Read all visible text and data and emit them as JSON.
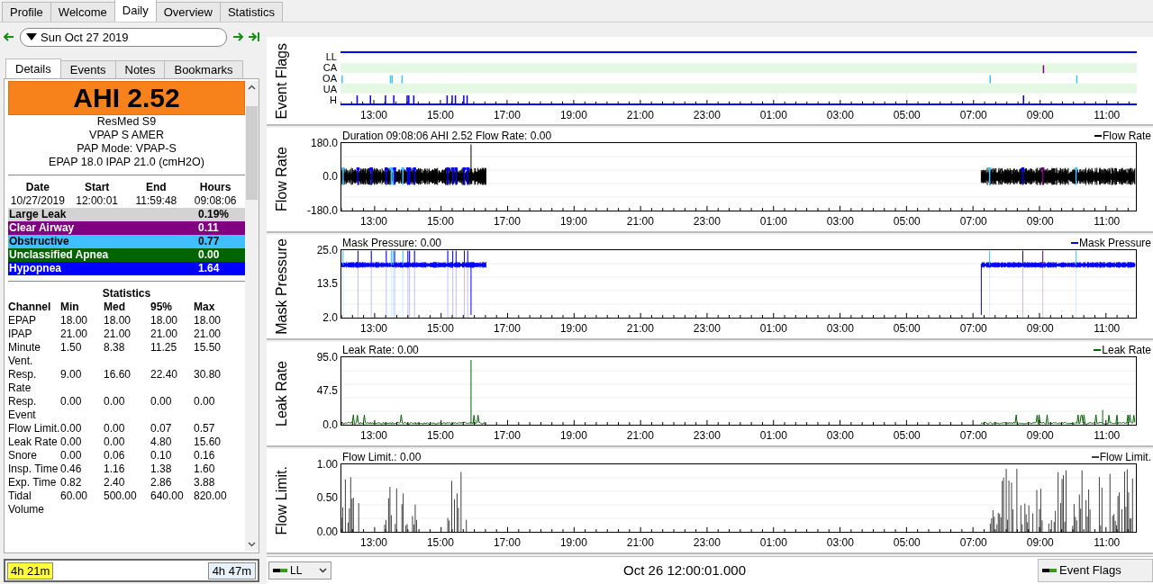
{
  "tabs": [
    {
      "label": "Profile",
      "selected": false
    },
    {
      "label": "Welcome",
      "selected": false
    },
    {
      "label": "Daily",
      "selected": true
    },
    {
      "label": "Overview",
      "selected": false
    },
    {
      "label": "Statistics",
      "selected": false
    }
  ],
  "date_nav": {
    "date": "Sun Oct 27 2019"
  },
  "detail_tabs": [
    {
      "label": "Details",
      "selected": true
    },
    {
      "label": "Events",
      "selected": false
    },
    {
      "label": "Notes",
      "selected": false
    },
    {
      "label": "Bookmarks",
      "selected": false
    }
  ],
  "summary": {
    "ahi": "AHI 2.52",
    "lines": [
      "ResMed S9",
      "VPAP S AMER",
      "PAP Mode: VPAP-S",
      "EPAP 18.0 IPAP 21.0 (cmH2O)"
    ],
    "session_columns": [
      "Date",
      "Start",
      "End",
      "Hours"
    ],
    "session_values": [
      "10/27/2019",
      "12:00:01",
      "11:59:48",
      "09:08:06"
    ],
    "indices": [
      {
        "label": "Large Leak",
        "value": "0.19%",
        "color": "#d3d3d3"
      },
      {
        "label": "Clear Airway",
        "value": "0.11",
        "color": "#800080"
      },
      {
        "label": "Obstructive",
        "value": "0.77",
        "color": "#40c0ff"
      },
      {
        "label": "Unclassified Apnea",
        "value": "0.00",
        "color": "#006400"
      },
      {
        "label": "Hypopnea",
        "value": "1.64",
        "color": "#0000ff"
      }
    ]
  },
  "statistics": {
    "title": "Statistics",
    "columns": [
      "Channel",
      "Min",
      "Med",
      "95%",
      "Max"
    ],
    "rows": [
      [
        "EPAP",
        "18.00",
        "18.00",
        "18.00",
        "18.00"
      ],
      [
        "IPAP",
        "21.00",
        "21.00",
        "21.00",
        "21.00"
      ],
      [
        "Minute Vent.",
        "1.50",
        "8.38",
        "11.25",
        "15.50"
      ],
      [
        "Resp. Rate",
        "9.00",
        "16.60",
        "22.40",
        "30.80"
      ],
      [
        "Resp. Event",
        "0.00",
        "0.00",
        "0.00",
        "0.00"
      ],
      [
        "Flow Limit.",
        "0.00",
        "0.00",
        "0.07",
        "0.57"
      ],
      [
        "Leak Rate",
        "0.00",
        "0.00",
        "4.80",
        "15.60"
      ],
      [
        "Snore",
        "0.00",
        "0.06",
        "0.10",
        "0.16"
      ],
      [
        "Insp. Time",
        "0.46",
        "1.16",
        "1.38",
        "1.60"
      ],
      [
        "Exp. Time",
        "0.82",
        "2.40",
        "2.86",
        "3.88"
      ],
      [
        "Tidal Volume",
        "60.00",
        "500.00",
        "640.00",
        "820.00"
      ]
    ]
  },
  "durations": {
    "left": "4h 21m",
    "right": "4h 47m"
  },
  "graphs": [
    {
      "kind": "flags",
      "label": "Event Flags",
      "rows": [
        "LL",
        "CA",
        "OA",
        "UA",
        "H"
      ],
      "xticks": [
        "13:00",
        "15:00",
        "17:00",
        "19:00",
        "21:00",
        "23:00",
        "01:00",
        "03:00",
        "05:00",
        "07:00",
        "09:00",
        "11:00"
      ]
    },
    {
      "kind": "flow",
      "label": "Flow Rate",
      "title": "Duration 09:08:06 AHI 2.52 Flow Rate: 0.00",
      "legend": "Flow Rate",
      "color": "#000000",
      "yticks": [
        "180.0",
        "0.0",
        "-180.0"
      ],
      "xticks": [
        "13:00",
        "15:00",
        "17:00",
        "19:00",
        "21:00",
        "23:00",
        "01:00",
        "03:00",
        "05:00",
        "07:00",
        "09:00",
        "11:00"
      ]
    },
    {
      "kind": "pressure",
      "label": "Mask Pressure",
      "title": "Mask Pressure: 0.00",
      "legend": "Mask Pressure",
      "color": "#0000ff",
      "yticks": [
        "25.0",
        "13.5",
        "2.0"
      ],
      "xticks": [
        "13:00",
        "15:00",
        "17:00",
        "19:00",
        "21:00",
        "23:00",
        "01:00",
        "03:00",
        "05:00",
        "07:00",
        "09:00",
        "11:00"
      ]
    },
    {
      "kind": "leak",
      "label": "Leak Rate",
      "title": "Leak Rate: 0.00",
      "legend": "Leak Rate",
      "color": "#006400",
      "yticks": [
        "95.0",
        "47.5",
        "0.0"
      ],
      "xticks": [
        "13:00",
        "15:00",
        "17:00",
        "19:00",
        "21:00",
        "23:00",
        "01:00",
        "03:00",
        "05:00",
        "07:00",
        "09:00",
        "11:00"
      ]
    },
    {
      "kind": "limit",
      "label": "Flow Limit.",
      "title": "Flow Limit.: 0.00",
      "legend": "Flow Limit.",
      "color": "#404040",
      "yticks": [
        "1.00",
        "0.50",
        "0.00"
      ],
      "xticks": [
        "13:00",
        "15:00",
        "17:00",
        "19:00",
        "21:00",
        "23:00",
        "01:00",
        "03:00",
        "05:00",
        "07:00",
        "09:00",
        "11:00"
      ]
    }
  ],
  "bottom_bar": {
    "channel": "LL",
    "time": "Oct 26 12:00:01.000",
    "layer_button": "Event Flags"
  }
}
